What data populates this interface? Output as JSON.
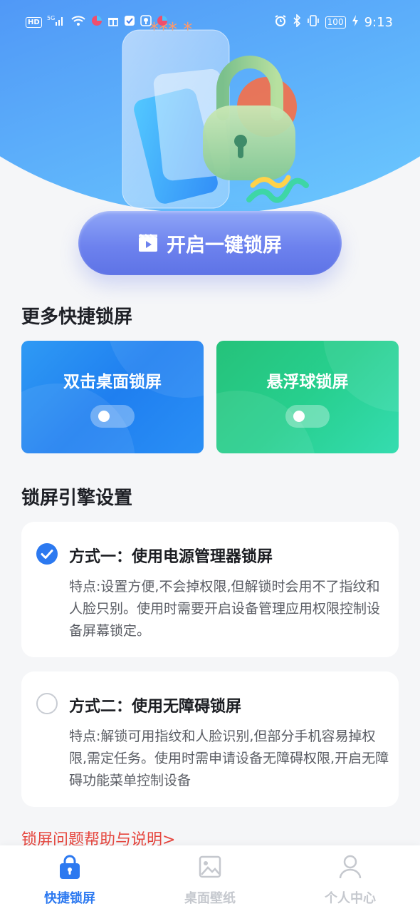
{
  "status_bar": {
    "left_chips": [
      "HD",
      "5G"
    ],
    "battery": "100",
    "time": "9:13"
  },
  "hero": {
    "main_button_label": "开启一键锁屏",
    "icon": "video-play-icon"
  },
  "more_section": {
    "title": "更多快捷锁屏",
    "cards": [
      {
        "label": "双击桌面锁屏",
        "enabled": false
      },
      {
        "label": "悬浮球锁屏",
        "enabled": false
      }
    ]
  },
  "engine_section": {
    "title": "锁屏引擎设置",
    "options": [
      {
        "title": "方式一：使用电源管理器锁屏",
        "desc": "特点:设置方便,不会掉权限,但解锁时会用不了指纹和人脸只别。使用时需要开启设备管理应用权限控制设备屏幕锁定。",
        "selected": true
      },
      {
        "title": "方式二：使用无障碍锁屏",
        "desc": "特点:解锁可用指纹和人脸识别,但部分手机容易掉权限,需定任务。使用时需申请设备无障碍权限,开启无障碍功能菜单控制设备",
        "selected": false
      }
    ]
  },
  "help_link": "锁屏问题帮助与说明>",
  "tabs": [
    {
      "label": "快捷锁屏",
      "icon": "lock-icon",
      "active": true
    },
    {
      "label": "桌面壁纸",
      "icon": "image-icon",
      "active": false
    },
    {
      "label": "个人中心",
      "icon": "person-icon",
      "active": false
    }
  ],
  "colors": {
    "accent": "#2c79f0",
    "link": "#e6463e",
    "card_blue": "#1f7ff0",
    "card_green": "#27cf8e"
  }
}
